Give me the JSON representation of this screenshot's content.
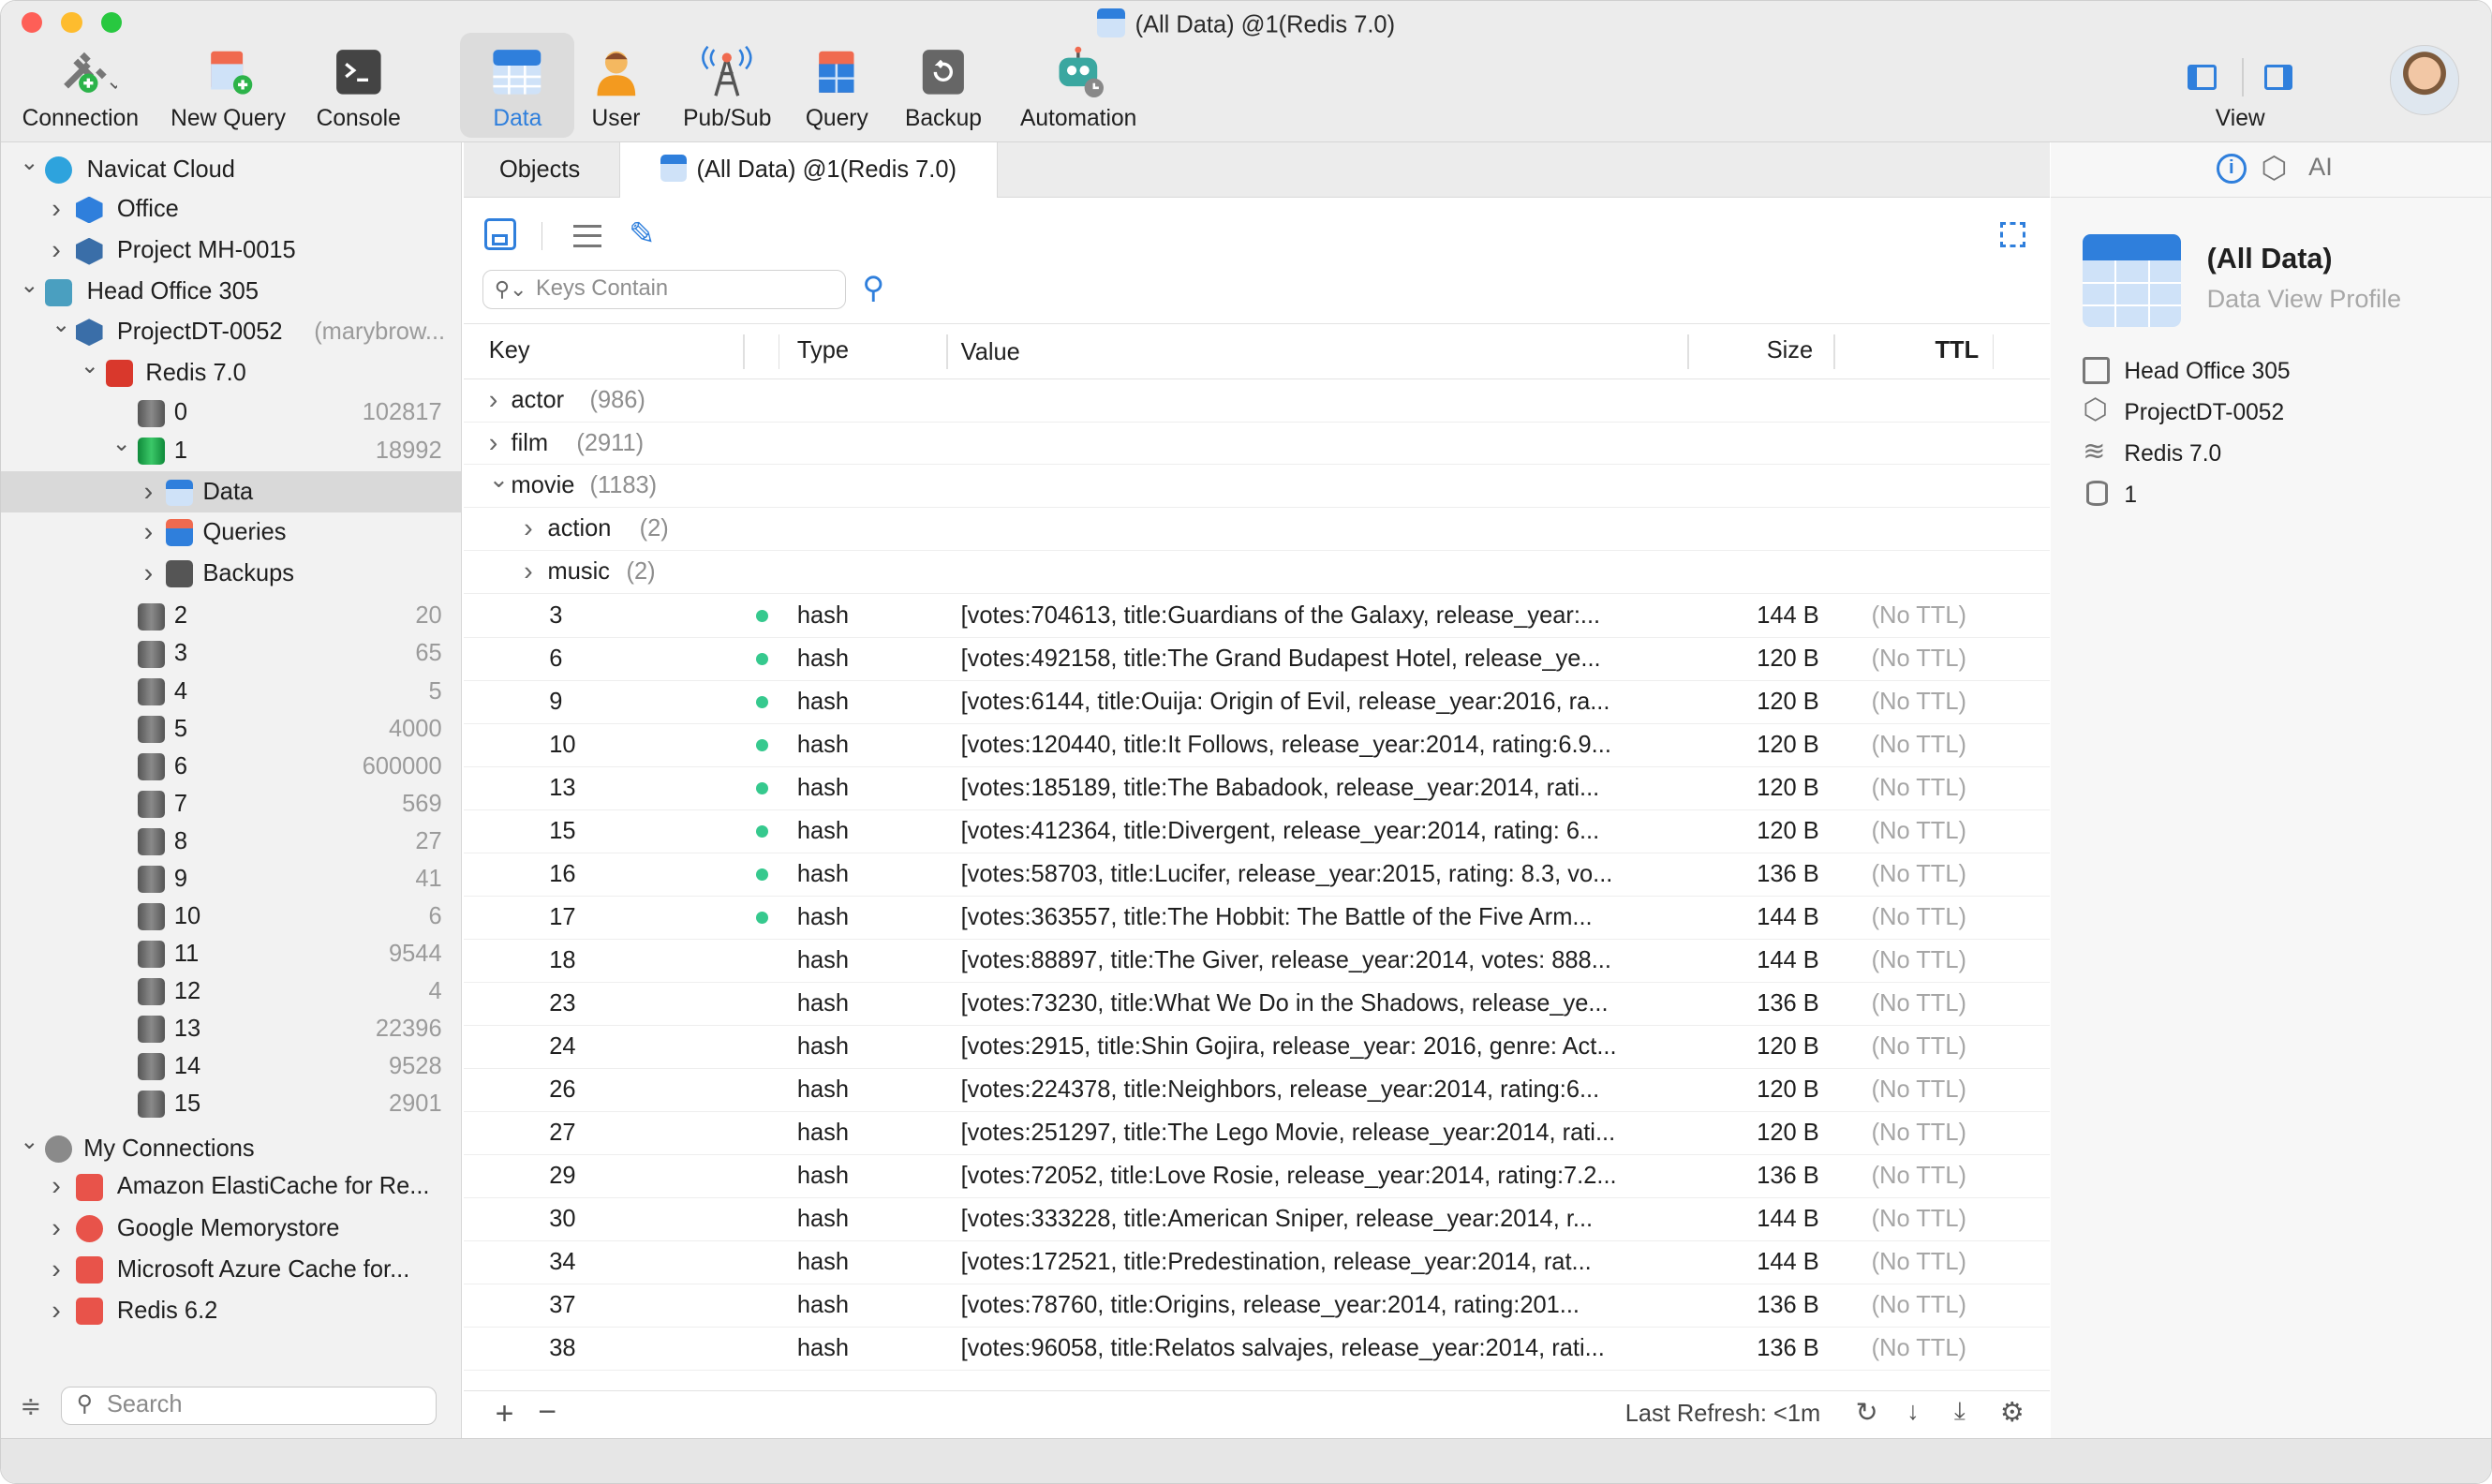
{
  "window": {
    "title": "(All Data) @1(Redis 7.0)"
  },
  "toolbar": {
    "connection": "Connection",
    "new_query": "New Query",
    "console": "Console",
    "data": "Data",
    "user": "User",
    "pubsub": "Pub/Sub",
    "query": "Query",
    "backup": "Backup",
    "automation": "Automation",
    "view": "View"
  },
  "sidebar": {
    "navicat_cloud": "Navicat Cloud",
    "office": "Office",
    "project_mh": "Project MH-0015",
    "head_office": "Head Office 305",
    "projectdt": "ProjectDT-0052",
    "projectdt_owner": "(marybrow...",
    "redis7": "Redis 7.0",
    "db0": {
      "name": "0",
      "count": "102817"
    },
    "db1": {
      "name": "1",
      "count": "18992"
    },
    "data": "Data",
    "queries": "Queries",
    "backups": "Backups",
    "dbs": [
      {
        "name": "2",
        "count": "20"
      },
      {
        "name": "3",
        "count": "65"
      },
      {
        "name": "4",
        "count": "5"
      },
      {
        "name": "5",
        "count": "4000"
      },
      {
        "name": "6",
        "count": "600000"
      },
      {
        "name": "7",
        "count": "569"
      },
      {
        "name": "8",
        "count": "27"
      },
      {
        "name": "9",
        "count": "41"
      },
      {
        "name": "10",
        "count": "6"
      },
      {
        "name": "11",
        "count": "9544"
      },
      {
        "name": "12",
        "count": "4"
      },
      {
        "name": "13",
        "count": "22396"
      },
      {
        "name": "14",
        "count": "9528"
      },
      {
        "name": "15",
        "count": "2901"
      }
    ],
    "my_connections": "My Connections",
    "amazon": "Amazon ElastiCache for Re...",
    "google": "Google Memorystore",
    "azure": "Microsoft Azure Cache for...",
    "redis62": "Redis 6.2",
    "search_placeholder": "Search"
  },
  "tabs": {
    "objects": "Objects",
    "all_data": "(All Data) @1(Redis 7.0)"
  },
  "main": {
    "keys_placeholder": "Keys Contain",
    "columns": {
      "key": "Key",
      "type": "Type",
      "value": "Value",
      "size": "Size",
      "ttl": "TTL"
    },
    "groups": [
      {
        "name": "actor",
        "count": "(986)"
      },
      {
        "name": "film",
        "count": "(2911)"
      },
      {
        "name": "movie",
        "count": "(1183)"
      },
      {
        "name": "action",
        "count": "(2)"
      },
      {
        "name": "music",
        "count": "(2)"
      }
    ],
    "rows": [
      {
        "key": "3",
        "type": "hash",
        "value": "[votes:704613, title:Guardians of the Galaxy, release_year:...",
        "size": "144 B",
        "ttl": "(No TTL)",
        "dot": true
      },
      {
        "key": "6",
        "type": "hash",
        "value": "[votes:492158, title:The Grand Budapest Hotel, release_ye...",
        "size": "120 B",
        "ttl": "(No TTL)",
        "dot": true
      },
      {
        "key": "9",
        "type": "hash",
        "value": "[votes:6144, title:Ouija: Origin of Evil, release_year:2016, ra...",
        "size": "120 B",
        "ttl": "(No TTL)",
        "dot": true
      },
      {
        "key": "10",
        "type": "hash",
        "value": "[votes:120440, title:It Follows, release_year:2014, rating:6.9...",
        "size": "120 B",
        "ttl": "(No TTL)",
        "dot": true
      },
      {
        "key": "13",
        "type": "hash",
        "value": "[votes:185189, title:The Babadook, release_year:2014, rati...",
        "size": "120 B",
        "ttl": "(No TTL)",
        "dot": true
      },
      {
        "key": "15",
        "type": "hash",
        "value": "[votes:412364, title:Divergent, release_year:2014, rating: 6...",
        "size": "120 B",
        "ttl": "(No TTL)",
        "dot": true
      },
      {
        "key": "16",
        "type": "hash",
        "value": "[votes:58703, title:Lucifer, release_year:2015, rating: 8.3, vo...",
        "size": "136 B",
        "ttl": "(No TTL)",
        "dot": true
      },
      {
        "key": "17",
        "type": "hash",
        "value": "[votes:363557, title:The Hobbit: The Battle of the Five Arm...",
        "size": "144 B",
        "ttl": "(No TTL)",
        "dot": true
      },
      {
        "key": "18",
        "type": "hash",
        "value": "[votes:88897, title:The Giver, release_year:2014, votes: 888...",
        "size": "144 B",
        "ttl": "(No TTL)",
        "dot": false
      },
      {
        "key": "23",
        "type": "hash",
        "value": "[votes:73230, title:What We Do in the Shadows, release_ye...",
        "size": "136 B",
        "ttl": "(No TTL)",
        "dot": false
      },
      {
        "key": "24",
        "type": "hash",
        "value": "[votes:2915, title:Shin Gojira, release_year: 2016, genre: Act...",
        "size": "120 B",
        "ttl": "(No TTL)",
        "dot": false
      },
      {
        "key": "26",
        "type": "hash",
        "value": "[votes:224378, title:Neighbors, release_year:2014, rating:6...",
        "size": "120 B",
        "ttl": "(No TTL)",
        "dot": false
      },
      {
        "key": "27",
        "type": "hash",
        "value": "[votes:251297, title:The Lego Movie, release_year:2014, rati...",
        "size": "120 B",
        "ttl": "(No TTL)",
        "dot": false
      },
      {
        "key": "29",
        "type": "hash",
        "value": "[votes:72052, title:Love Rosie, release_year:2014, rating:7.2...",
        "size": "136 B",
        "ttl": "(No TTL)",
        "dot": false
      },
      {
        "key": "30",
        "type": "hash",
        "value": "[votes:333228, title:American Sniper, release_year:2014, r...",
        "size": "144 B",
        "ttl": "(No TTL)",
        "dot": false
      },
      {
        "key": "34",
        "type": "hash",
        "value": "[votes:172521, title:Predestination, release_year:2014, rat...",
        "size": "144 B",
        "ttl": "(No TTL)",
        "dot": false
      },
      {
        "key": "37",
        "type": "hash",
        "value": "[votes:78760, title:Origins, release_year:2014, rating:201...",
        "size": "136 B",
        "ttl": "(No TTL)",
        "dot": false
      },
      {
        "key": "38",
        "type": "hash",
        "value": "[votes:96058, title:Relatos salvajes, release_year:2014, rati...",
        "size": "136 B",
        "ttl": "(No TTL)",
        "dot": false
      }
    ],
    "last_refresh": "Last Refresh: <1m"
  },
  "profile": {
    "title": "(All Data)",
    "subtitle": "Data View Profile",
    "ai": "AI",
    "items": [
      "Head Office 305",
      "ProjectDT-0052",
      "Redis 7.0",
      "1"
    ]
  },
  "colors": {
    "accent": "#2f7fdc",
    "dot": "#36c98e",
    "tab_active": "#dcdcdc"
  }
}
